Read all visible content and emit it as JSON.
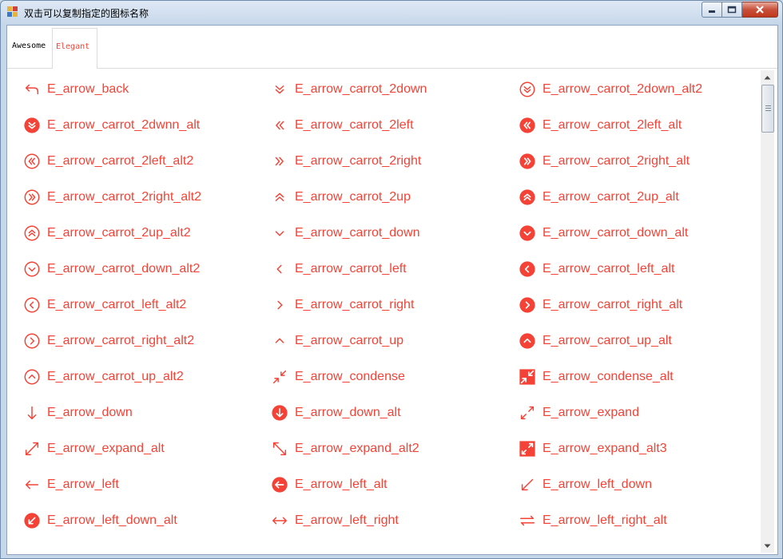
{
  "window": {
    "title": "双击可以复制指定的图标名称"
  },
  "tabs": [
    {
      "label": "Awesome"
    },
    {
      "label": "Elegant",
      "active": true
    }
  ],
  "accent_color": "#f44336",
  "icons": [
    {
      "name": "E_arrow_back",
      "icon": "arrow-back"
    },
    {
      "name": "E_arrow_carrot_2down",
      "icon": "double-chevron-down"
    },
    {
      "name": "E_arrow_carrot_2down_alt2",
      "icon": "double-chevron-down-circle-outline"
    },
    {
      "name": "E_arrow_carrot_2dwnn_alt",
      "icon": "double-chevron-down-circle-filled"
    },
    {
      "name": "E_arrow_carrot_2left",
      "icon": "double-chevron-left"
    },
    {
      "name": "E_arrow_carrot_2left_alt",
      "icon": "double-chevron-left-circle-filled"
    },
    {
      "name": "E_arrow_carrot_2left_alt2",
      "icon": "double-chevron-left-circle-outline"
    },
    {
      "name": "E_arrow_carrot_2right",
      "icon": "double-chevron-right"
    },
    {
      "name": "E_arrow_carrot_2right_alt",
      "icon": "double-chevron-right-circle-filled"
    },
    {
      "name": "E_arrow_carrot_2right_alt2",
      "icon": "double-chevron-right-circle-outline"
    },
    {
      "name": "E_arrow_carrot_2up",
      "icon": "double-chevron-up"
    },
    {
      "name": "E_arrow_carrot_2up_alt",
      "icon": "double-chevron-up-circle-filled"
    },
    {
      "name": "E_arrow_carrot_2up_alt2",
      "icon": "double-chevron-up-circle-outline"
    },
    {
      "name": "E_arrow_carrot_down",
      "icon": "chevron-down"
    },
    {
      "name": "E_arrow_carrot_down_alt",
      "icon": "chevron-down-circle-filled"
    },
    {
      "name": "E_arrow_carrot_down_alt2",
      "icon": "chevron-down-circle-outline"
    },
    {
      "name": "E_arrow_carrot_left",
      "icon": "chevron-left"
    },
    {
      "name": "E_arrow_carrot_left_alt",
      "icon": "chevron-left-circle-filled"
    },
    {
      "name": "E_arrow_carrot_left_alt2",
      "icon": "chevron-left-circle-outline"
    },
    {
      "name": "E_arrow_carrot_right",
      "icon": "chevron-right"
    },
    {
      "name": "E_arrow_carrot_right_alt",
      "icon": "chevron-right-circle-filled"
    },
    {
      "name": "E_arrow_carrot_right_alt2",
      "icon": "chevron-right-circle-outline"
    },
    {
      "name": "E_arrow_carrot_up",
      "icon": "chevron-up"
    },
    {
      "name": "E_arrow_carrot_up_alt",
      "icon": "chevron-up-circle-filled"
    },
    {
      "name": "E_arrow_carrot_up_alt2",
      "icon": "chevron-up-circle-outline"
    },
    {
      "name": "E_arrow_condense",
      "icon": "condense"
    },
    {
      "name": "E_arrow_condense_alt",
      "icon": "condense-square-filled"
    },
    {
      "name": "E_arrow_down",
      "icon": "arrow-down"
    },
    {
      "name": "E_arrow_down_alt",
      "icon": "arrow-down-circle-filled"
    },
    {
      "name": "E_arrow_expand",
      "icon": "expand"
    },
    {
      "name": "E_arrow_expand_alt",
      "icon": "expand-alt"
    },
    {
      "name": "E_arrow_expand_alt2",
      "icon": "expand-alt2"
    },
    {
      "name": "E_arrow_expand_alt3",
      "icon": "expand-square-filled"
    },
    {
      "name": "E_arrow_left",
      "icon": "arrow-left"
    },
    {
      "name": "E_arrow_left_alt",
      "icon": "arrow-left-circle-filled"
    },
    {
      "name": "E_arrow_left_down",
      "icon": "arrow-left-down"
    },
    {
      "name": "E_arrow_left_down_alt",
      "icon": "arrow-left-down-circle-filled"
    },
    {
      "name": "E_arrow_left_right",
      "icon": "arrow-left-right"
    },
    {
      "name": "E_arrow_left_right_alt",
      "icon": "arrow-left-right-alt"
    }
  ]
}
